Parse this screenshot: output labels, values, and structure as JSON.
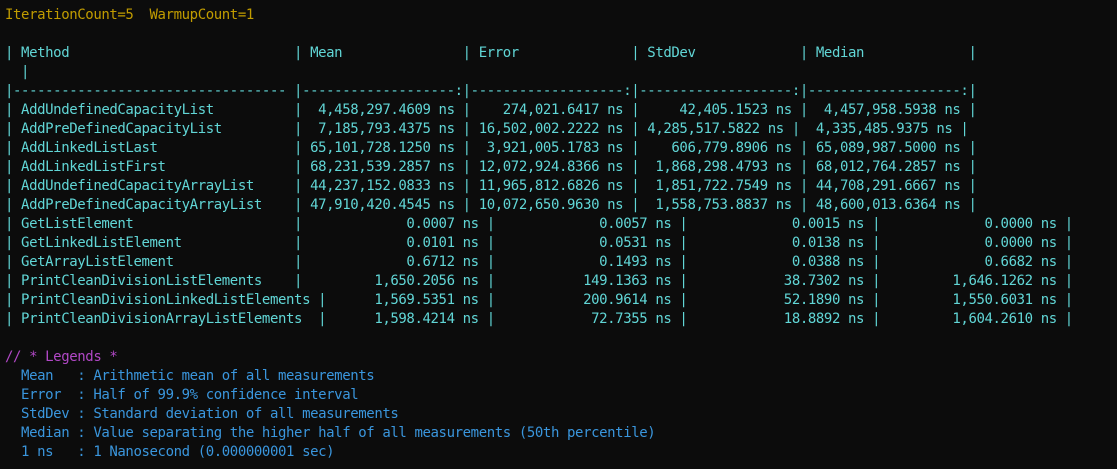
{
  "header": {
    "config_line": "IterationCount=5  WarmupCount=1"
  },
  "table": {
    "header_line": "| Method                            | Mean               | Error              | StdDev             | Median             |",
    "wrap_line": "  |",
    "separator_line": "|---------------------------------- |-------------------:|-------------------:|-------------------:|-------------------:|",
    "rows": [
      "| AddUndefinedCapacityList          |  4,458,297.4609 ns |    274,021.6417 ns |     42,405.1523 ns |  4,457,958.5938 ns |",
      "| AddPreDefinedCapacityList         |  7,185,793.4375 ns | 16,502,002.2222 ns | 4,285,517.5822 ns |  4,335,485.9375 ns |",
      "| AddLinkedListLast                 | 65,101,728.1250 ns |  3,921,005.1783 ns |    606,779.8906 ns | 65,089,987.5000 ns |",
      "| AddLinkedListFirst                | 68,231,539.2857 ns | 12,072,924.8366 ns |  1,868,298.4793 ns | 68,012,764.2857 ns |",
      "| AddUndefinedCapacityArrayList     | 44,237,152.0833 ns | 11,965,812.6826 ns |  1,851,722.7549 ns | 44,708,291.6667 ns |",
      "| AddPreDefinedCapacityArrayList    | 47,910,420.4545 ns | 10,072,650.9630 ns |  1,558,753.8837 ns | 48,600,013.6364 ns |",
      "| GetListElement                    |             0.0007 ns |             0.0057 ns |             0.0015 ns |             0.0000 ns |",
      "| GetLinkedListElement              |             0.0101 ns |             0.0531 ns |             0.0138 ns |             0.0000 ns |",
      "| GetArrayListElement               |             0.6712 ns |             0.1493 ns |             0.0388 ns |             0.6682 ns |",
      "| PrintCleanDivisionListElements    |         1,650.2056 ns |           149.1363 ns |            38.7302 ns |         1,646.1262 ns |",
      "| PrintCleanDivisionLinkedListElements |      1,569.5351 ns |           200.9614 ns |            52.1890 ns |         1,550.6031 ns |",
      "| PrintCleanDivisionArrayListElements  |      1,598.4214 ns |            72.7355 ns |            18.8892 ns |         1,604.2610 ns |"
    ]
  },
  "legend": {
    "title": "// * Legends *",
    "items": [
      "  Mean   : Arithmetic mean of all measurements",
      "  Error  : Half of 99.9% confidence interval",
      "  StdDev : Standard deviation of all measurements",
      "  Median : Value separating the higher half of all measurements (50th percentile)",
      "  1 ns   : 1 Nanosecond (0.000000001 sec)"
    ]
  },
  "colors": {
    "background": "#0c0c0c",
    "config": "#c19c00",
    "table": "#61d6d6",
    "legend_title": "#b148c6",
    "legend_text": "#3a96dd"
  }
}
